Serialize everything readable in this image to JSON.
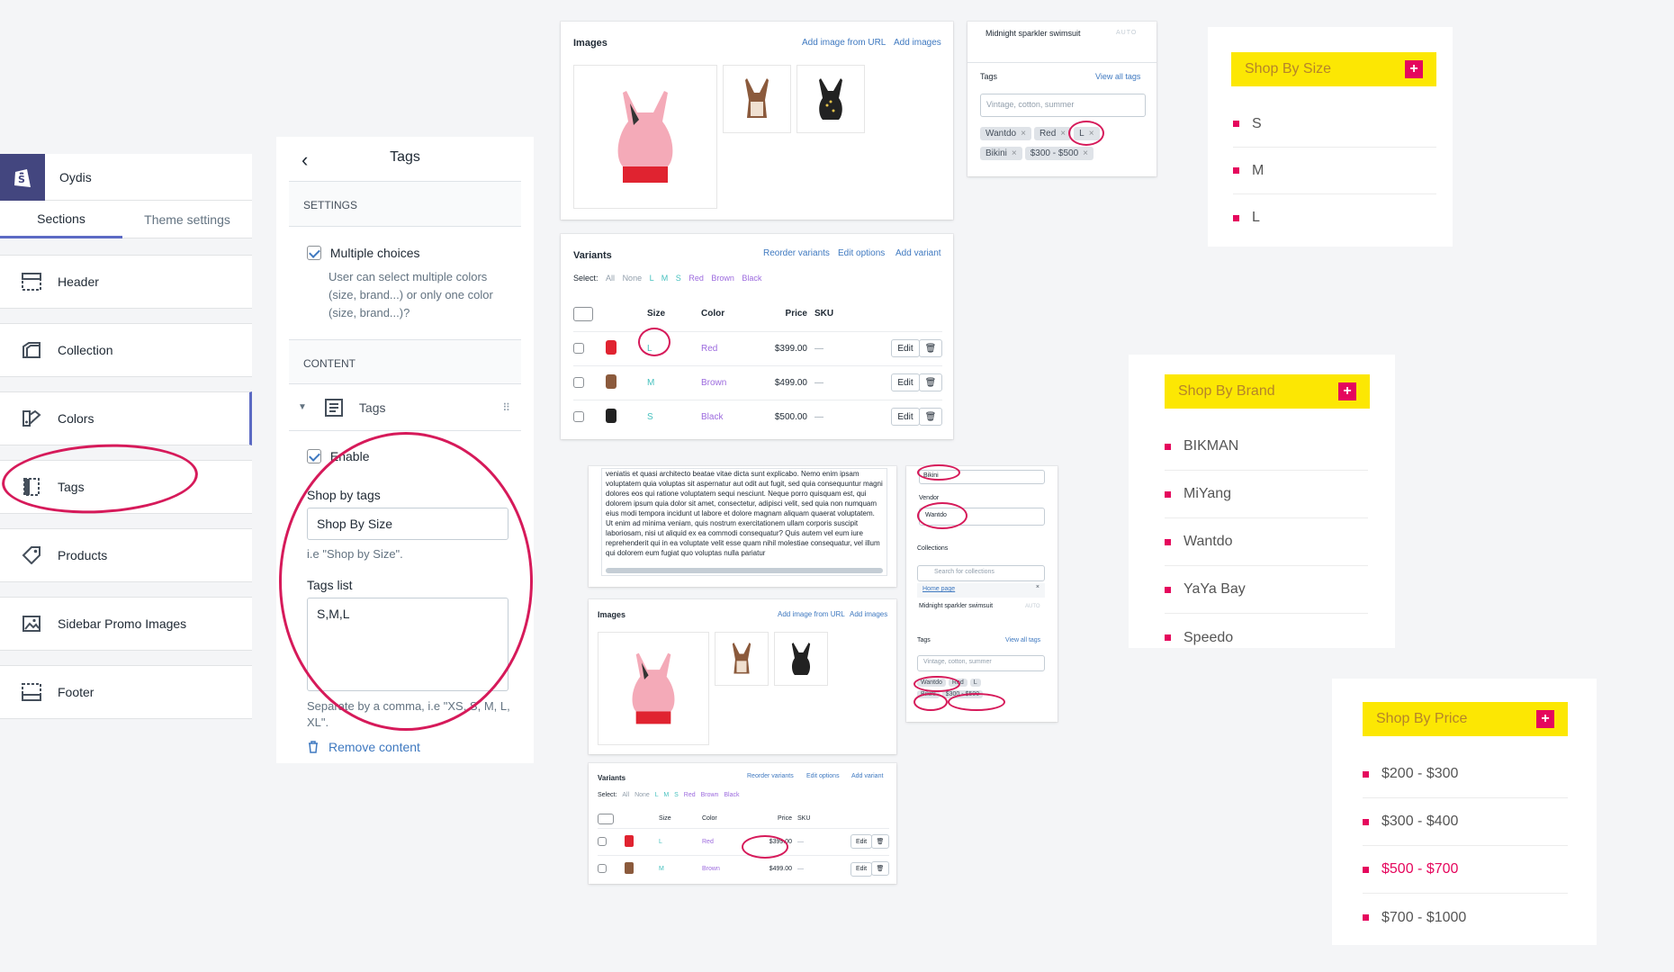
{
  "sidebar": {
    "store_name": "Oydis",
    "tabs": [
      "Sections",
      "Theme settings"
    ],
    "items": [
      "Header",
      "Collection",
      "Colors",
      "Tags",
      "Products",
      "Sidebar Promo Images",
      "Footer"
    ]
  },
  "tags_panel": {
    "title": "Tags",
    "settings_heading": "SETTINGS",
    "multiple_choices_label": "Multiple choices",
    "multiple_choices_help": "User can select multiple colors (size, brand...) or only one color (size, brand...)?",
    "content_heading": "CONTENT",
    "block_title": "Tags",
    "enable_label": "Enable",
    "shop_by_tags_label": "Shop by tags",
    "shop_by_tags_value": "Shop By Size",
    "shop_by_tags_help": "i.e \"Shop by Size\".",
    "tags_list_label": "Tags list",
    "tags_list_value": "S,M,L",
    "tags_list_help": "Separate by a comma, i.e \"XS, S, M, L, XL\".",
    "remove_label": "Remove content"
  },
  "images_card": {
    "title": "Images",
    "add_url": "Add image from URL",
    "add_images": "Add images"
  },
  "variants_card": {
    "title": "Variants",
    "actions": [
      "Reorder variants",
      "Edit options",
      "Add variant"
    ],
    "select_label": "Select:",
    "select_options": [
      "All",
      "None",
      "L",
      "M",
      "S",
      "Red",
      "Brown",
      "Black"
    ],
    "columns": [
      "Size",
      "Color",
      "Price",
      "SKU"
    ],
    "rows": [
      {
        "size": "L",
        "color": "Red",
        "price": "$399.00",
        "sku": "—"
      },
      {
        "size": "M",
        "color": "Brown",
        "price": "$499.00",
        "sku": "—"
      },
      {
        "size": "S",
        "color": "Black",
        "price": "$500.00",
        "sku": "—"
      }
    ],
    "edit_label": "Edit"
  },
  "tags_card": {
    "product": "Midnight sparkler swimsuit",
    "auto": "AUTO",
    "title": "Tags",
    "view_all": "View all tags",
    "placeholder": "Vintage, cotton, summer",
    "tags": [
      "Wantdo",
      "Red",
      "L",
      "Bikini",
      "$300 - $500"
    ]
  },
  "description_text": "veniatis et quasi architecto beatae vitae dicta sunt explicabo. Nemo enim ipsam voluptatem quia voluptas sit aspernatur aut odit aut fugit, sed quia consequuntur magni dolores eos qui ratione voluptatem sequi nesciunt. Neque porro quisquam est, qui dolorem ipsum quia dolor sit amet, consectetur, adipisci velit, sed quia non numquam eius modi tempora incidunt ut labore et dolore magnam aliquam quaerat voluptatem. Ut enim ad minima veniam, quis nostrum exercitationem ullam corporis suscipit laboriosam, nisi ut aliquid ex ea commodi consequatur? Quis autem vel eum iure reprehenderit qui in ea voluptate velit esse quam nihil molestiae consequatur, vel illum qui dolorem eum fugiat quo voluptas nulla pariatur",
  "org_card": {
    "type_value": "Bikini",
    "vendor_label": "Vendor",
    "vendor_value": "Wantdo",
    "collections_label": "Collections",
    "search_placeholder": "Search for collections",
    "collection_link": "Home page",
    "product": "Midnight sparkler swimsuit",
    "auto": "AUTO",
    "tags_label": "Tags",
    "view_all": "View all tags",
    "tag_placeholder": "Vintage, cotton, summer",
    "tags": [
      "Wantdo",
      "Red",
      "L",
      "Bikini",
      "$300 - $500"
    ]
  },
  "widgets": {
    "size": {
      "title": "Shop By Size",
      "items": [
        "S",
        "M",
        "L"
      ]
    },
    "brand": {
      "title": "Shop By Brand",
      "items": [
        "BIKMAN",
        "MiYang",
        "Wantdo",
        "YaYa Bay",
        "Speedo"
      ]
    },
    "price": {
      "title": "Shop By Price",
      "items": [
        "$200 - $300",
        "$300 - $400",
        "$500 - $700",
        "$700 - $1000"
      ],
      "active_index": 2
    }
  },
  "colors": {
    "accent": "#e5075d",
    "yellow": "#fce703",
    "admin_purple": "#5c6ac4",
    "highlight": "#d61a5a"
  }
}
